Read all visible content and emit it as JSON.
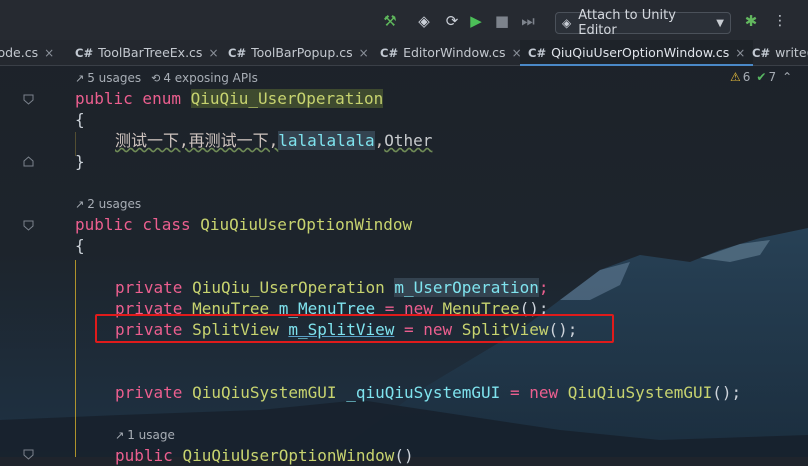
{
  "toolbar": {
    "attach_label": "Attach to Unity Editor",
    "icons": [
      "hammer-icon",
      "unity-icon",
      "refresh-build-icon",
      "run-icon",
      "stop-icon",
      "step-icon",
      "bug-icon"
    ]
  },
  "tabs": [
    {
      "prefix": "",
      "label": "lode.cs"
    },
    {
      "prefix": "C#",
      "label": "ToolBarTreeEx.cs"
    },
    {
      "prefix": "C#",
      "label": "ToolBarPopup.cs"
    },
    {
      "prefix": "C#",
      "label": "EditorWindow.cs"
    },
    {
      "prefix": "C#",
      "label": "QiuQiuUserOptionWindow.cs",
      "active": true
    },
    {
      "prefix": "C#",
      "label": "write("
    }
  ],
  "inspections": {
    "warnings": "6",
    "ok": "7"
  },
  "hints": {
    "enum_usages": "5 usages",
    "enum_exposing": "4 exposing APIs",
    "class_usages": "2 usages",
    "ctor_usages": "1 usage"
  },
  "code": {
    "l1_kw": "public enum ",
    "l1_name": "QiuQiu_UserOperation",
    "l2": "{",
    "l3_a": "测试一下,再测试一下,",
    "l3_b": "lalalalala",
    "l3_c": ",",
    "l3_d": "Other",
    "l4": "}",
    "l5_kw": "public class ",
    "l5_name": "QiuQiuUserOptionWindow",
    "l6": "{",
    "l7_kw": "private ",
    "l7_type": "QiuQiu_UserOperation ",
    "l7_field": "m_UserOperation",
    "l7_end": ";",
    "l8_kw": "private ",
    "l8_type": "MenuTree ",
    "l8_field": "m_MenuTree",
    "l8_eq": " = ",
    "l8_new": "new ",
    "l8_ctor": "MenuTree",
    "l8_end": "();",
    "l9_kw": "private ",
    "l9_type": "SplitView ",
    "l9_field": "m_SplitView",
    "l9_eq": " = ",
    "l9_new": "new ",
    "l9_ctor": "SplitView",
    "l9_end": "();",
    "l10_kw": "private ",
    "l10_type": "QiuQiuSystemGUI ",
    "l10_field": "_qiuQiuSystemGUI",
    "l10_eq": " = ",
    "l10_new": "new ",
    "l10_ctor": "QiuQiuSystemGUI",
    "l10_end": "();",
    "l11_kw": "public ",
    "l11_name": "QiuQiuUserOptionWindow",
    "l11_end": "()"
  }
}
